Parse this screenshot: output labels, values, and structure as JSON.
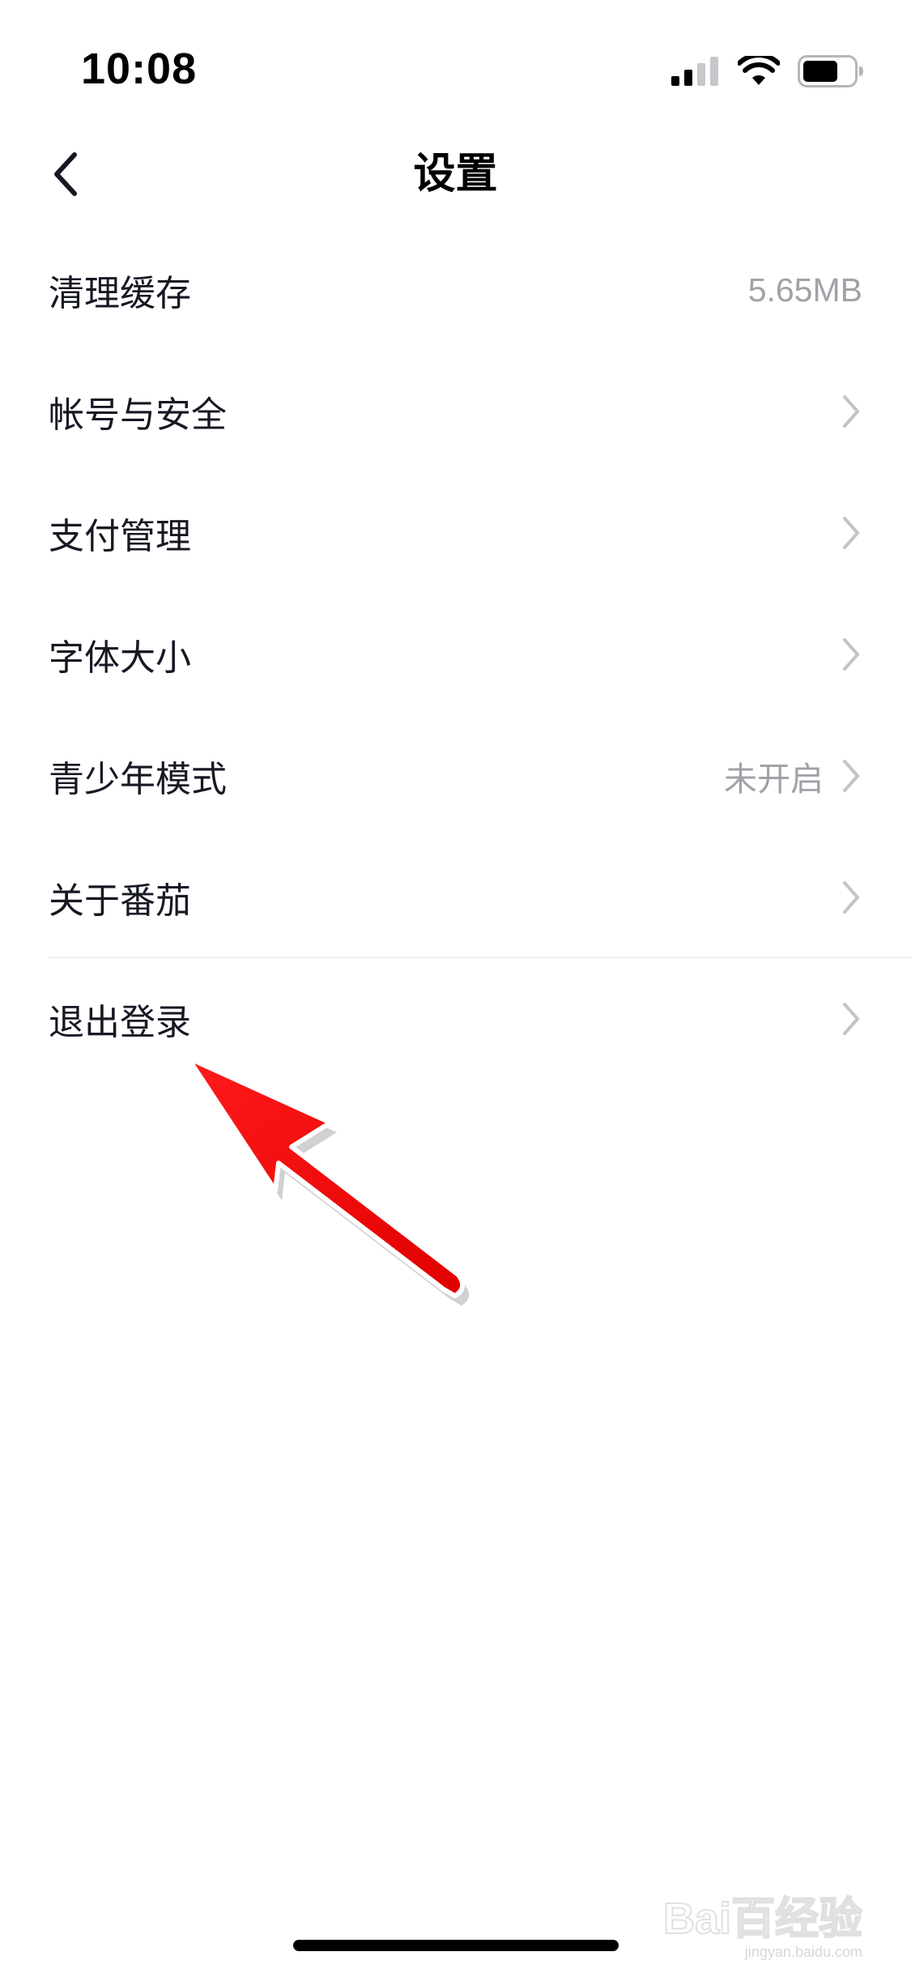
{
  "status_bar": {
    "time": "10:08",
    "icons": [
      "cellular-signal-icon",
      "wifi-icon",
      "battery-icon"
    ]
  },
  "header": {
    "back_icon": "chevron-left-icon",
    "title": "设置"
  },
  "settings": [
    {
      "id": "clear-cache",
      "label": "清理缓存",
      "value": "5.65MB",
      "chevron": false
    },
    {
      "id": "account-security",
      "label": "帐号与安全",
      "value": "",
      "chevron": true
    },
    {
      "id": "payment-management",
      "label": "支付管理",
      "value": "",
      "chevron": true
    },
    {
      "id": "font-size",
      "label": "字体大小",
      "value": "",
      "chevron": true
    },
    {
      "id": "teen-mode",
      "label": "青少年模式",
      "value": "未开启",
      "chevron": true
    },
    {
      "id": "about",
      "label": "关于番茄",
      "value": "",
      "chevron": true
    },
    {
      "id": "logout",
      "label": "退出登录",
      "value": "",
      "chevron": true
    }
  ],
  "annotation": {
    "icon": "red-arrow-pointer",
    "color": "#ff0000"
  },
  "watermark": {
    "main": "Bai百经验",
    "sub": "jingyan.baidu.com"
  },
  "colors": {
    "text": "#161823",
    "secondary": "#a1a2a8",
    "chevron": "#c4c4c8",
    "divider": "#f0f0f2"
  }
}
